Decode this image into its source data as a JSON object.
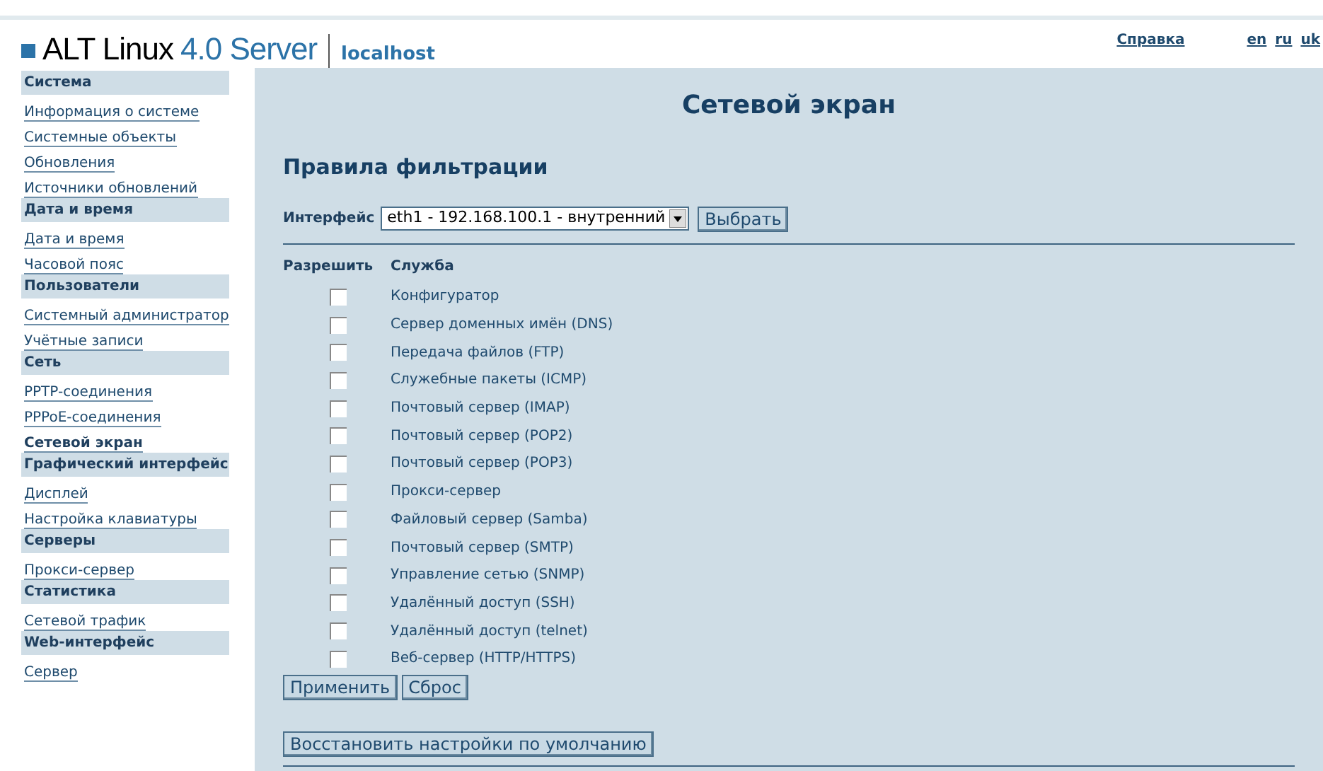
{
  "header": {
    "product": "ALT Linux",
    "version": "4.0 Server",
    "host": "localhost",
    "help": "Справка",
    "languages": [
      "en",
      "ru",
      "uk"
    ]
  },
  "sidebar": [
    {
      "title": "Система",
      "items": [
        {
          "label": "Информация о системе",
          "selected": false
        },
        {
          "label": "Системные объекты",
          "selected": false
        },
        {
          "label": "Обновления",
          "selected": false
        },
        {
          "label": "Источники обновлений",
          "selected": false
        }
      ]
    },
    {
      "title": "Дата и время",
      "items": [
        {
          "label": "Дата и время",
          "selected": false
        },
        {
          "label": "Часовой пояс",
          "selected": false
        }
      ]
    },
    {
      "title": "Пользователи",
      "items": [
        {
          "label": "Системный администратор",
          "selected": false
        },
        {
          "label": "Учётные записи",
          "selected": false
        }
      ]
    },
    {
      "title": "Сеть",
      "items": [
        {
          "label": "PPTP-соединения",
          "selected": false
        },
        {
          "label": "PPPoE-соединения",
          "selected": false
        },
        {
          "label": "Сетевой экран",
          "selected": true
        }
      ]
    },
    {
      "title": "Графический интерфейс",
      "items": [
        {
          "label": "Дисплей",
          "selected": false
        },
        {
          "label": "Настройка клавиатуры",
          "selected": false
        }
      ]
    },
    {
      "title": "Серверы",
      "items": [
        {
          "label": "Прокси-сервер",
          "selected": false
        }
      ]
    },
    {
      "title": "Статистика",
      "items": [
        {
          "label": "Сетевой трафик",
          "selected": false
        }
      ]
    },
    {
      "title": "Web-интерфейс",
      "items": [
        {
          "label": "Сервер",
          "selected": false
        }
      ]
    }
  ],
  "page_title": "Сетевой экран",
  "section_title": "Правила фильтрации",
  "interface": {
    "label": "Интерфейс",
    "value": "eth1 - 192.168.100.1 - внутренний",
    "button": "Выбрать"
  },
  "table": {
    "columns": [
      "Разрешить",
      "Служба"
    ],
    "rows": [
      {
        "service": "Конфигуратор",
        "checked": false
      },
      {
        "service": "Сервер доменных имён (DNS)",
        "checked": false
      },
      {
        "service": "Передача файлов (FTP)",
        "checked": false
      },
      {
        "service": "Служебные пакеты (ICMP)",
        "checked": false
      },
      {
        "service": "Почтовый сервер (IMAP)",
        "checked": false
      },
      {
        "service": "Почтовый сервер (POP2)",
        "checked": false
      },
      {
        "service": "Почтовый сервер (POP3)",
        "checked": false
      },
      {
        "service": "Прокси-сервер",
        "checked": false
      },
      {
        "service": "Файловый сервер (Samba)",
        "checked": false
      },
      {
        "service": "Почтовый сервер (SMTP)",
        "checked": false
      },
      {
        "service": "Управление сетью (SNMP)",
        "checked": false
      },
      {
        "service": "Удалённый доступ (SSH)",
        "checked": false
      },
      {
        "service": "Удалённый доступ (telnet)",
        "checked": false
      },
      {
        "service": "Веб-сервер (HTTP/HTTPS)",
        "checked": false
      }
    ]
  },
  "buttons": [
    "Применить",
    "Сброс"
  ],
  "restore_button": "Восстановить настройки по умолчанию"
}
